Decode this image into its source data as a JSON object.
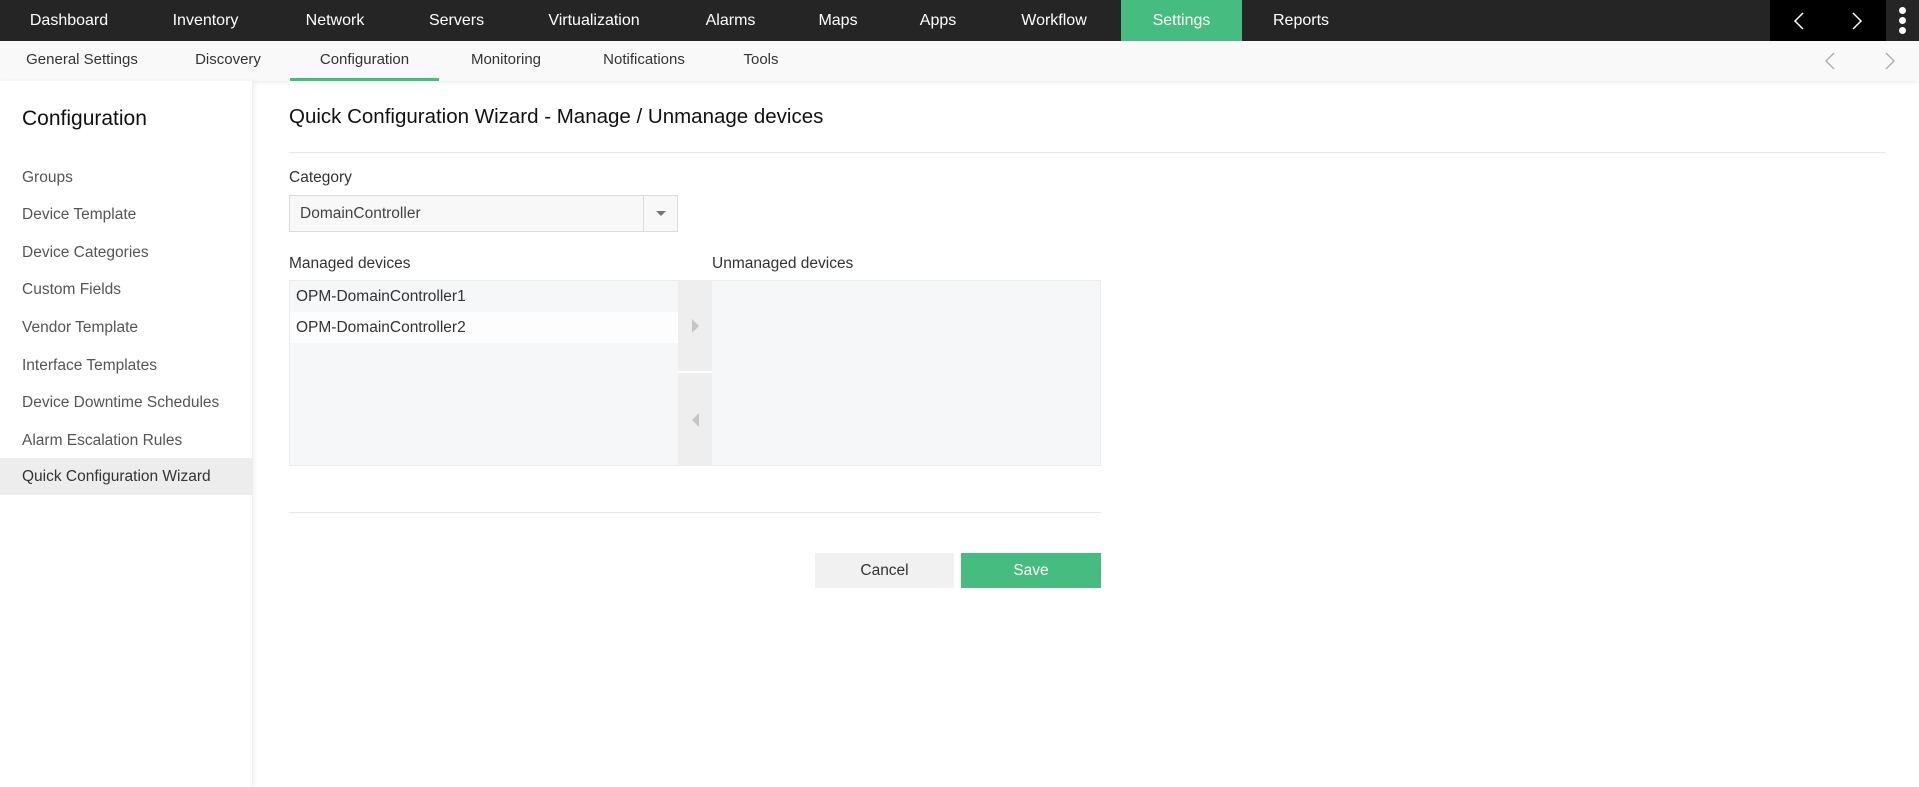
{
  "topnav": {
    "items": [
      {
        "label": "Dashboard"
      },
      {
        "label": "Inventory"
      },
      {
        "label": "Network"
      },
      {
        "label": "Servers"
      },
      {
        "label": "Virtualization"
      },
      {
        "label": "Alarms"
      },
      {
        "label": "Maps"
      },
      {
        "label": "Apps"
      },
      {
        "label": "Workflow"
      },
      {
        "label": "Settings",
        "active": true
      },
      {
        "label": "Reports"
      }
    ],
    "active_color": "#47bc80"
  },
  "subnav": {
    "items": [
      {
        "label": "General Settings"
      },
      {
        "label": "Discovery"
      },
      {
        "label": "Configuration",
        "active": true
      },
      {
        "label": "Monitoring"
      },
      {
        "label": "Notifications"
      },
      {
        "label": "Tools"
      }
    ]
  },
  "sidebar": {
    "title": "Configuration",
    "items": [
      {
        "label": "Groups"
      },
      {
        "label": "Device Template"
      },
      {
        "label": "Device Categories"
      },
      {
        "label": "Custom Fields"
      },
      {
        "label": "Vendor Template"
      },
      {
        "label": "Interface Templates"
      },
      {
        "label": "Device Downtime Schedules"
      },
      {
        "label": "Alarm Escalation Rules"
      },
      {
        "label": "Quick Configuration Wizard",
        "active": true
      }
    ]
  },
  "main": {
    "title": "Quick Configuration Wizard - Manage / Unmanage devices",
    "category_label": "Category",
    "category_value": "DomainController",
    "managed_label": "Managed devices",
    "unmanaged_label": "Unmanaged devices",
    "managed_devices": [
      "OPM-DomainController1",
      "OPM-DomainController2"
    ],
    "unmanaged_devices": [],
    "cancel_label": "Cancel",
    "save_label": "Save"
  }
}
